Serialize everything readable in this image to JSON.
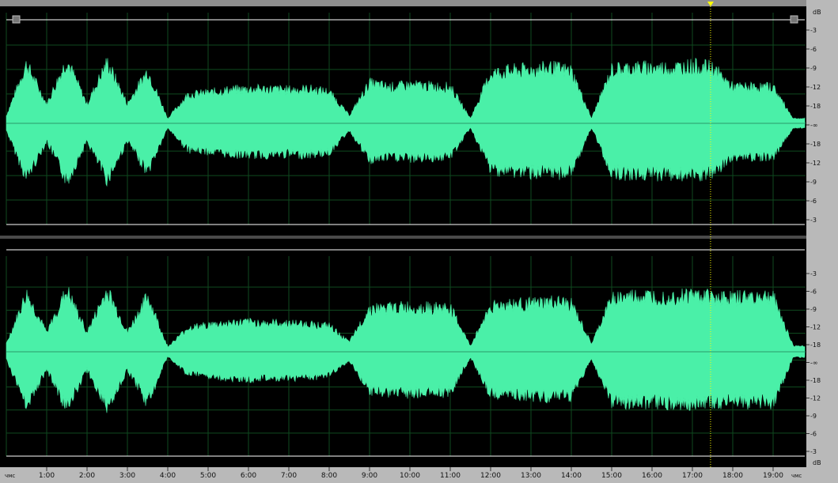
{
  "app": {
    "view": "waveform-editor"
  },
  "colors": {
    "background": "#000000",
    "waveform": "#4af0a8",
    "grid": "#0f4a1f",
    "ruler_background": "#b9b9b9",
    "playhead": "#ffff00",
    "channel_frame": "#ffffff"
  },
  "amplitude_ruler": {
    "unit": "dB",
    "channel_labels": [
      "-3",
      "-6",
      "-9",
      "-12",
      "-18",
      "-∞",
      "-18",
      "-12",
      "-9",
      "-6",
      "-3"
    ]
  },
  "time_ruler": {
    "start_label": "чмс",
    "end_label": "чмс",
    "labels": [
      "1:00",
      "2:00",
      "3:00",
      "4:00",
      "5:00",
      "6:00",
      "7:00",
      "8:00",
      "9:00",
      "10:00",
      "11:00",
      "12:00",
      "13:00",
      "14:00",
      "15:00",
      "16:00",
      "17:00",
      "18:00",
      "19:00"
    ]
  },
  "playhead": {
    "time_minutes": 17.45
  },
  "chart_data": {
    "type": "area",
    "x_unit": "minutes",
    "xlim": [
      0,
      19.8
    ],
    "x": [
      0.0,
      0.5,
      1.0,
      1.5,
      2.0,
      2.5,
      3.0,
      3.5,
      4.0,
      4.5,
      5.0,
      5.5,
      6.0,
      6.5,
      7.0,
      7.5,
      8.0,
      8.5,
      9.0,
      9.5,
      10.0,
      10.5,
      11.0,
      11.5,
      12.0,
      12.5,
      13.0,
      13.5,
      14.0,
      14.5,
      15.0,
      15.5,
      16.0,
      16.5,
      17.0,
      17.5,
      18.0,
      18.5,
      19.0,
      19.5
    ],
    "series": [
      {
        "channel": "top",
        "values": [
          0.08,
          0.62,
          0.2,
          0.66,
          0.2,
          0.64,
          0.2,
          0.55,
          0.05,
          0.3,
          0.32,
          0.35,
          0.36,
          0.36,
          0.35,
          0.36,
          0.33,
          0.08,
          0.42,
          0.38,
          0.4,
          0.39,
          0.38,
          0.05,
          0.52,
          0.55,
          0.56,
          0.58,
          0.55,
          0.05,
          0.56,
          0.58,
          0.58,
          0.58,
          0.6,
          0.58,
          0.38,
          0.38,
          0.38,
          0.05
        ]
      },
      {
        "channel": "bottom",
        "values": [
          0.08,
          0.6,
          0.2,
          0.64,
          0.2,
          0.64,
          0.2,
          0.58,
          0.05,
          0.25,
          0.28,
          0.3,
          0.31,
          0.3,
          0.3,
          0.29,
          0.27,
          0.1,
          0.45,
          0.46,
          0.47,
          0.46,
          0.46,
          0.06,
          0.48,
          0.5,
          0.5,
          0.52,
          0.5,
          0.08,
          0.56,
          0.58,
          0.58,
          0.58,
          0.6,
          0.58,
          0.56,
          0.58,
          0.58,
          0.06
        ]
      }
    ]
  }
}
